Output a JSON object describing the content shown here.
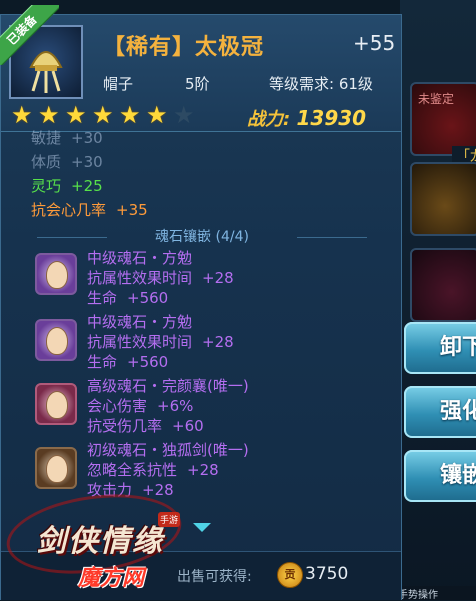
{
  "item": {
    "equipped_badge": "已装备",
    "name": "【稀有】太极冠",
    "enhance": "+55",
    "type": "帽子",
    "tier": "5阶",
    "level_req": "等级需求: 61级",
    "stars_filled": 6,
    "stars_total": 7,
    "power_label": "战力:",
    "power_value": "13930"
  },
  "stats": [
    {
      "label": "敏捷",
      "value": "+30"
    },
    {
      "label": "体质",
      "value": "+30"
    },
    {
      "label": "灵巧",
      "value": "+25"
    },
    {
      "label": "抗会心几率",
      "value": "+35"
    }
  ],
  "soulstone_title": "魂石镶嵌 (4/4)",
  "soulstones": [
    {
      "name": "中级魂石・方勉",
      "line1_label": "抗属性效果时间",
      "line1_value": "+28",
      "line2_label": "生命",
      "line2_value": "+560",
      "icon": "scholar-portrait-icon"
    },
    {
      "name": "中级魂石・方勉",
      "line1_label": "抗属性效果时间",
      "line1_value": "+28",
      "line2_label": "生命",
      "line2_value": "+560",
      "icon": "scholar-portrait-icon"
    },
    {
      "name": "高级魂石・完颜襄(唯一)",
      "line1_label": "会心伤害",
      "line1_value": "+6%",
      "line2_label": "抗受伤几率",
      "line2_value": "+60",
      "icon": "princess-portrait-icon"
    },
    {
      "name": "初级魂石・独孤剑(唯一)",
      "line1_label": "忽略全系抗性",
      "line1_value": "+28",
      "line2_label": "攻击力",
      "line2_value": "+28",
      "icon": "swordsman-portrait-icon"
    }
  ],
  "footer": {
    "sell_label": "出售可获得:",
    "coin_label": "贡",
    "sell_price": "3750"
  },
  "side": {
    "unidentified": "未鉴定",
    "dragon_label": "「龙",
    "btn_unequip": "卸下",
    "btn_enhance": "强化",
    "btn_inlay": "镶嵌",
    "hint": "手势操作"
  },
  "logo": {
    "title": "剑侠情缘",
    "site": "魔方网",
    "tag": "手游"
  }
}
